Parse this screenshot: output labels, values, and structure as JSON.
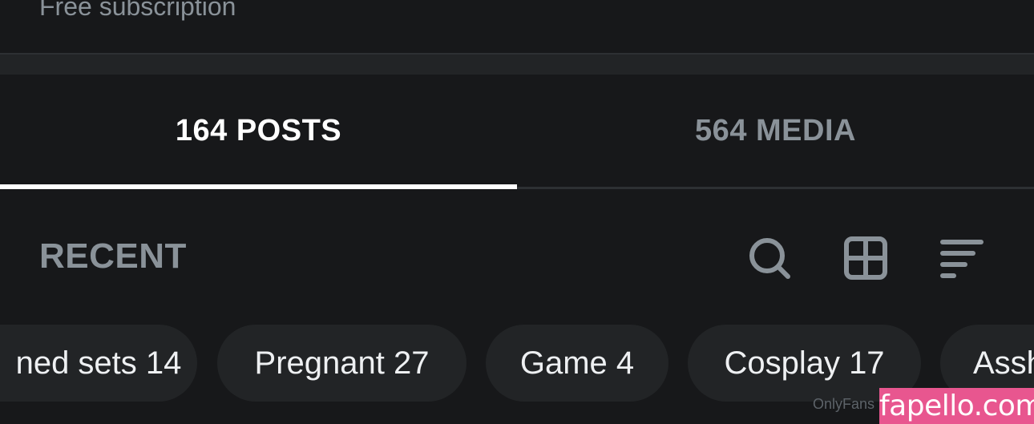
{
  "profile": {
    "subscription_text": "Free subscription"
  },
  "tabs": [
    {
      "label": "164 POSTS",
      "active": true
    },
    {
      "label": "564 MEDIA",
      "active": false
    }
  ],
  "filter_bar": {
    "sort_label": "RECENT",
    "icons": [
      "search-icon",
      "grid-view-icon",
      "sort-icon"
    ]
  },
  "categories": [
    {
      "label": "ned sets 14"
    },
    {
      "label": "Pregnant 27"
    },
    {
      "label": "Game 4"
    },
    {
      "label": "Cosplay 17"
    },
    {
      "label": "Assh"
    }
  ],
  "watermarks": {
    "onlyfans": "OnlyFans",
    "fapello": "fapello.com"
  },
  "colors": {
    "background": "#17181a",
    "muted_text": "#8a9299",
    "chip_background": "#222426",
    "active_tab": "#ffffff",
    "fapello_brand": "#e8568f"
  }
}
